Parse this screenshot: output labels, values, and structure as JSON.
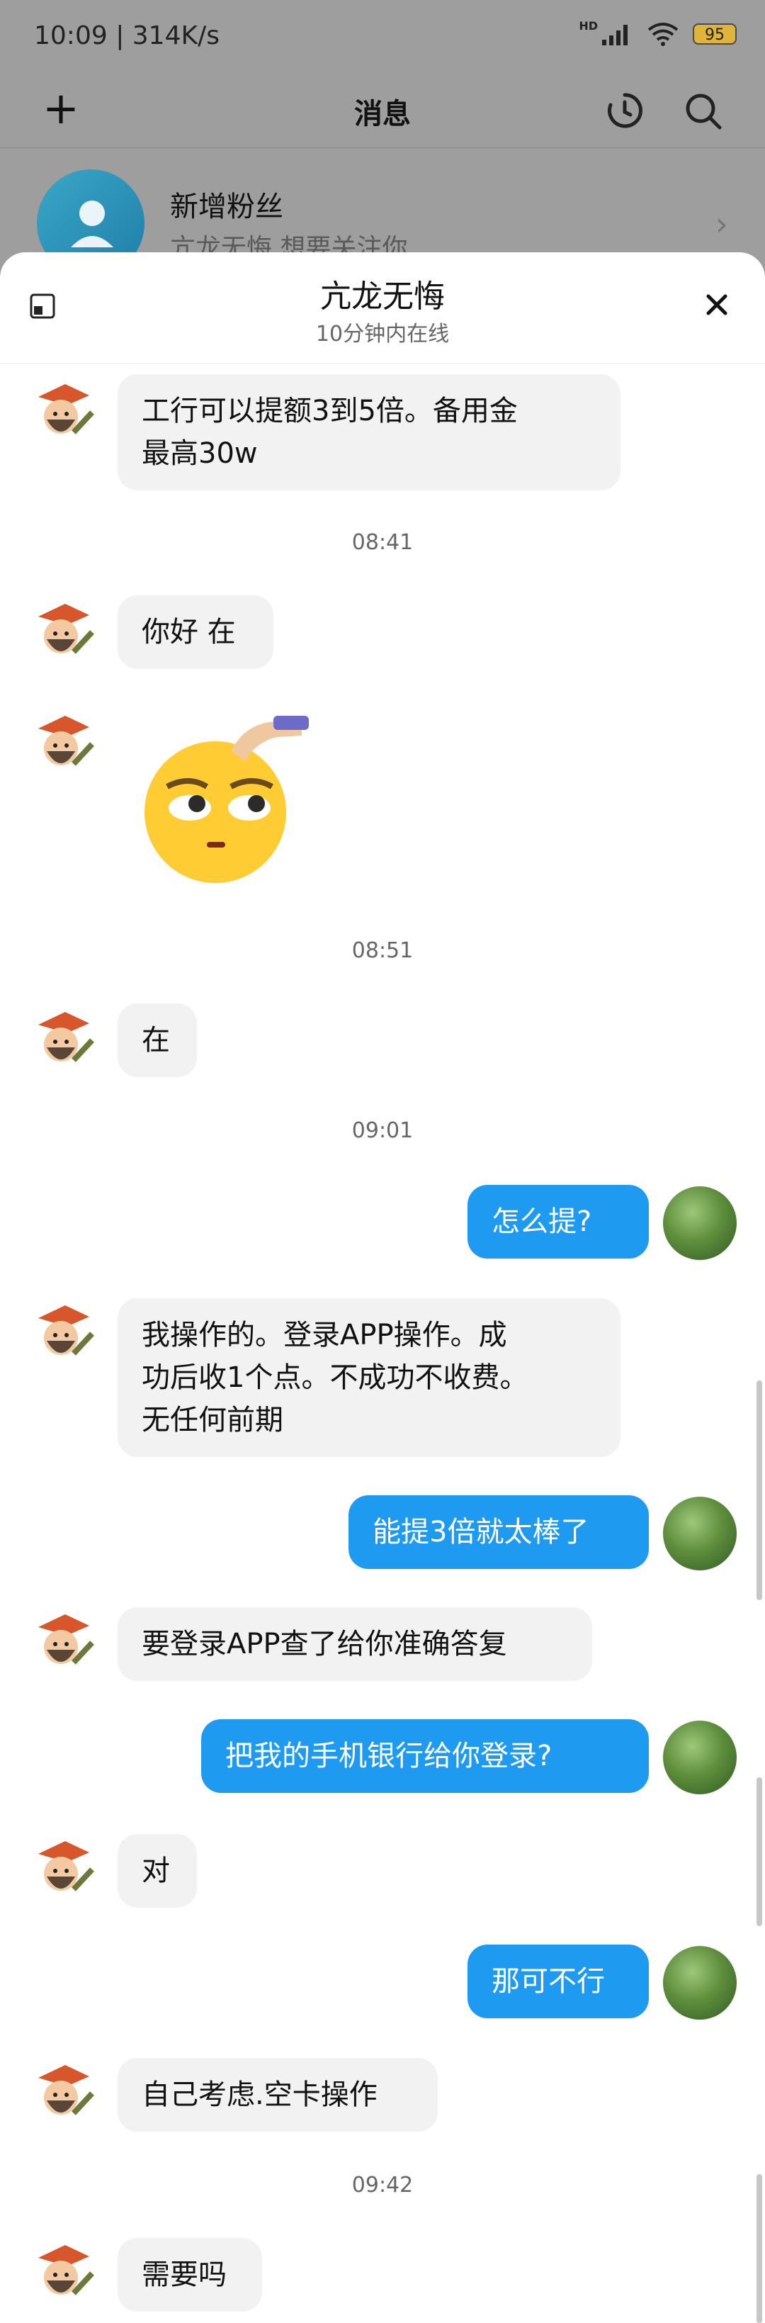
{
  "status_bar": {
    "time_speed": "10:09 | 314K/s",
    "network_label": "HD",
    "battery": "95"
  },
  "top_bar": {
    "title": "消息",
    "plus_icon": "plus-icon",
    "refresh_icon": "refresh-icon",
    "search_icon": "search-icon"
  },
  "background_row": {
    "title": "新增粉丝",
    "subtitle": "亢龙无悔 想要关注你"
  },
  "chat": {
    "title": "亢龙无悔",
    "subtitle": "10分钟内在线",
    "messages": [
      {
        "from": "them",
        "text": "工行可以提额3到5倍。备用金\n最高30w"
      },
      {
        "type": "time",
        "text": "08:41"
      },
      {
        "from": "them",
        "text": "你好 在"
      },
      {
        "from": "them",
        "type": "sticker",
        "icon": "eye-roll-emoji-sticker"
      },
      {
        "type": "time",
        "text": "08:51"
      },
      {
        "from": "them",
        "text": "在"
      },
      {
        "type": "time",
        "text": "09:01"
      },
      {
        "from": "me",
        "text": "怎么提?"
      },
      {
        "from": "them",
        "text": "我操作的。登录APP操作。成\n功后收1个点。不成功不收费。\n无任何前期"
      },
      {
        "from": "me",
        "text": "能提3倍就太棒了"
      },
      {
        "from": "them",
        "text": "要登录APP查了给你准确答复"
      },
      {
        "from": "me",
        "text": "把我的手机银行给你登录?"
      },
      {
        "from": "them",
        "text": "对"
      },
      {
        "from": "me",
        "text": "那可不行"
      },
      {
        "from": "them",
        "text": "自己考虑.空卡操作"
      },
      {
        "type": "time",
        "text": "09:42"
      },
      {
        "from": "them",
        "text": "需要吗"
      }
    ]
  },
  "colors": {
    "incoming_bubble": "#f2f2f2",
    "outgoing_bubble": "#1e9bf0",
    "overlay_dim": "#9e9e9e"
  }
}
